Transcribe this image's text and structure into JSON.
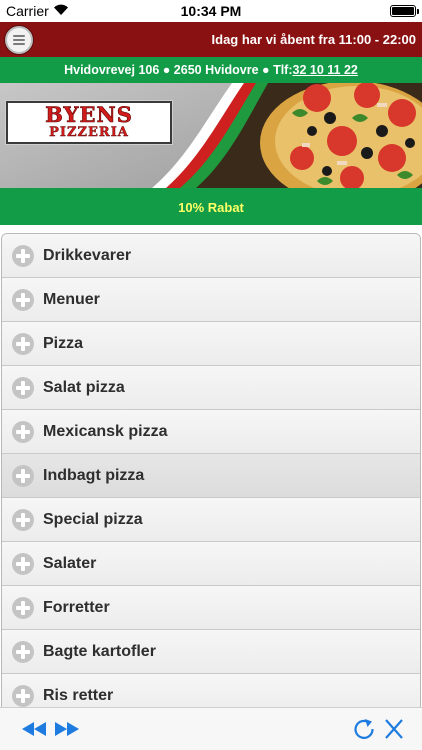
{
  "status_bar": {
    "carrier": "Carrier",
    "time": "10:34 PM"
  },
  "header": {
    "menu_icon": "hamburger-icon",
    "opening_hours": "Idag har vi åbent fra 11:00 - 22:00"
  },
  "address_bar": {
    "address": "Hvidovrevej 106 ● 2650 Hvidovre ● Tlf:",
    "phone": "32 10 11 22"
  },
  "banner": {
    "logo_line1": "BYENS",
    "logo_line2": "PIZZERIA"
  },
  "discount": "10% Rabat",
  "categories": [
    {
      "label": "Drikkevarer"
    },
    {
      "label": "Menuer"
    },
    {
      "label": "Pizza"
    },
    {
      "label": "Salat pizza"
    },
    {
      "label": "Mexicansk pizza"
    },
    {
      "label": "Indbagt pizza",
      "active": true
    },
    {
      "label": "Special pizza"
    },
    {
      "label": "Salater"
    },
    {
      "label": "Forretter"
    },
    {
      "label": "Bagte kartofler"
    },
    {
      "label": "Ris retter"
    }
  ],
  "toolbar": {
    "back_icon": "rewind-icon",
    "forward_icon": "fast-forward-icon",
    "reload_icon": "reload-icon",
    "close_icon": "close-icon"
  },
  "colors": {
    "header_red": "#8a1111",
    "brand_green": "#129c48",
    "discount_yellow": "#ffff66",
    "toolbar_blue": "#1e7be0"
  }
}
